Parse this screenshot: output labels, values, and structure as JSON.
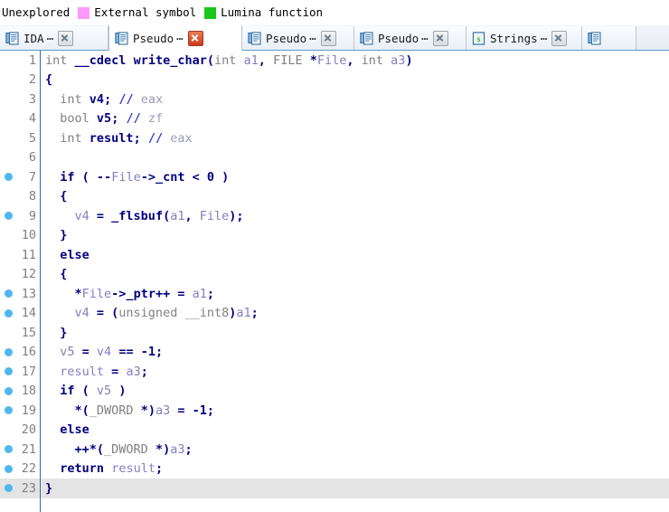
{
  "legend": {
    "items": [
      {
        "label": "Unexplored",
        "swatch": null,
        "icon_name": "legend-label-unexplored"
      },
      {
        "label": "External symbol",
        "swatch": "#ff99ff",
        "icon_name": "legend-swatch-external-symbol"
      },
      {
        "label": "Lumina function",
        "swatch": "#19c819",
        "icon_name": "legend-swatch-lumina-function"
      }
    ]
  },
  "tabs": [
    {
      "label": "IDA",
      "ellipsis": "⋯",
      "icon_name": "document-icon",
      "close_icon": "close-icon",
      "active": false,
      "close_style": "grey"
    },
    {
      "label": "Pseudo",
      "ellipsis": "⋯",
      "icon_name": "document-icon",
      "close_icon": "close-icon",
      "active": true,
      "close_style": "red"
    },
    {
      "label": "Pseudo",
      "ellipsis": "⋯",
      "icon_name": "document-icon",
      "close_icon": "close-icon",
      "active": false,
      "close_style": "grey"
    },
    {
      "label": "Pseudo",
      "ellipsis": "⋯",
      "icon_name": "document-icon",
      "close_icon": "close-icon",
      "active": false,
      "close_style": "grey"
    },
    {
      "label": "Strings",
      "ellipsis": "⋯",
      "icon_name": "strings-icon",
      "close_icon": "close-icon",
      "active": false,
      "close_style": "grey"
    },
    {
      "label": "",
      "ellipsis": "",
      "icon_name": "document-icon",
      "close_icon": "",
      "active": false,
      "close_style": "none"
    }
  ],
  "code": {
    "function_signature": "int __cdecl write_char(int a1, FILE *File, int a3)",
    "lines": [
      {
        "no": "1",
        "bp": false,
        "highlight": false,
        "tokens": [
          {
            "t": "int",
            "c": "t-type"
          },
          {
            "t": " ",
            "c": "t-plain"
          },
          {
            "t": "__cdecl",
            "c": "t-kw"
          },
          {
            "t": " ",
            "c": "t-plain"
          },
          {
            "t": "write_char",
            "c": "t-fn"
          },
          {
            "t": "(",
            "c": "t-punc"
          },
          {
            "t": "int",
            "c": "t-type"
          },
          {
            "t": " ",
            "c": "t-plain"
          },
          {
            "t": "a1",
            "c": "t-var"
          },
          {
            "t": ", ",
            "c": "t-punc"
          },
          {
            "t": "FILE",
            "c": "t-type"
          },
          {
            "t": " ",
            "c": "t-plain"
          },
          {
            "t": "*",
            "c": "t-punc"
          },
          {
            "t": "File",
            "c": "t-var"
          },
          {
            "t": ", ",
            "c": "t-punc"
          },
          {
            "t": "int",
            "c": "t-type"
          },
          {
            "t": " ",
            "c": "t-plain"
          },
          {
            "t": "a3",
            "c": "t-var"
          },
          {
            "t": ")",
            "c": "t-punc"
          }
        ]
      },
      {
        "no": "2",
        "bp": false,
        "highlight": false,
        "tokens": [
          {
            "t": "{",
            "c": "t-punc"
          }
        ]
      },
      {
        "no": "3",
        "bp": false,
        "highlight": false,
        "tokens": [
          {
            "t": "  ",
            "c": "t-plain"
          },
          {
            "t": "int",
            "c": "t-type"
          },
          {
            "t": " ",
            "c": "t-plain"
          },
          {
            "t": "v4",
            "c": "t-plain"
          },
          {
            "t": "; ",
            "c": "t-punc"
          },
          {
            "t": "//",
            "c": "t-cmtm"
          },
          {
            "t": " eax",
            "c": "t-cmt"
          }
        ]
      },
      {
        "no": "4",
        "bp": false,
        "highlight": false,
        "tokens": [
          {
            "t": "  ",
            "c": "t-plain"
          },
          {
            "t": "bool",
            "c": "t-type"
          },
          {
            "t": " ",
            "c": "t-plain"
          },
          {
            "t": "v5",
            "c": "t-plain"
          },
          {
            "t": "; ",
            "c": "t-punc"
          },
          {
            "t": "//",
            "c": "t-cmtm"
          },
          {
            "t": " zf",
            "c": "t-cmt"
          }
        ]
      },
      {
        "no": "5",
        "bp": false,
        "highlight": false,
        "tokens": [
          {
            "t": "  ",
            "c": "t-plain"
          },
          {
            "t": "int",
            "c": "t-type"
          },
          {
            "t": " ",
            "c": "t-plain"
          },
          {
            "t": "result",
            "c": "t-plain"
          },
          {
            "t": "; ",
            "c": "t-punc"
          },
          {
            "t": "//",
            "c": "t-cmtm"
          },
          {
            "t": " eax",
            "c": "t-cmt"
          }
        ]
      },
      {
        "no": "6",
        "bp": false,
        "highlight": false,
        "tokens": [
          {
            "t": "",
            "c": "t-plain"
          }
        ]
      },
      {
        "no": "7",
        "bp": true,
        "highlight": false,
        "tokens": [
          {
            "t": "  ",
            "c": "t-plain"
          },
          {
            "t": "if",
            "c": "t-kw"
          },
          {
            "t": " ( ",
            "c": "t-punc"
          },
          {
            "t": "--",
            "c": "t-punc"
          },
          {
            "t": "File",
            "c": "t-var"
          },
          {
            "t": "->",
            "c": "t-punc"
          },
          {
            "t": "_cnt",
            "c": "t-mem"
          },
          {
            "t": " < ",
            "c": "t-punc"
          },
          {
            "t": "0",
            "c": "t-num"
          },
          {
            "t": " )",
            "c": "t-punc"
          }
        ]
      },
      {
        "no": "8",
        "bp": false,
        "highlight": false,
        "tokens": [
          {
            "t": "  ",
            "c": "t-plain"
          },
          {
            "t": "{",
            "c": "t-punc"
          }
        ]
      },
      {
        "no": "9",
        "bp": true,
        "highlight": false,
        "tokens": [
          {
            "t": "    ",
            "c": "t-plain"
          },
          {
            "t": "v4",
            "c": "t-var"
          },
          {
            "t": " = ",
            "c": "t-punc"
          },
          {
            "t": "_flsbuf",
            "c": "t-fn"
          },
          {
            "t": "(",
            "c": "t-punc"
          },
          {
            "t": "a1",
            "c": "t-var"
          },
          {
            "t": ", ",
            "c": "t-punc"
          },
          {
            "t": "File",
            "c": "t-var"
          },
          {
            "t": ");",
            "c": "t-punc"
          }
        ]
      },
      {
        "no": "10",
        "bp": false,
        "highlight": false,
        "tokens": [
          {
            "t": "  ",
            "c": "t-plain"
          },
          {
            "t": "}",
            "c": "t-punc"
          }
        ]
      },
      {
        "no": "11",
        "bp": false,
        "highlight": false,
        "tokens": [
          {
            "t": "  ",
            "c": "t-plain"
          },
          {
            "t": "else",
            "c": "t-kw"
          }
        ]
      },
      {
        "no": "12",
        "bp": false,
        "highlight": false,
        "tokens": [
          {
            "t": "  ",
            "c": "t-plain"
          },
          {
            "t": "{",
            "c": "t-punc"
          }
        ]
      },
      {
        "no": "13",
        "bp": true,
        "highlight": false,
        "tokens": [
          {
            "t": "    ",
            "c": "t-plain"
          },
          {
            "t": "*",
            "c": "t-punc"
          },
          {
            "t": "File",
            "c": "t-var"
          },
          {
            "t": "->",
            "c": "t-punc"
          },
          {
            "t": "_ptr",
            "c": "t-mem"
          },
          {
            "t": "++ = ",
            "c": "t-punc"
          },
          {
            "t": "a1",
            "c": "t-var"
          },
          {
            "t": ";",
            "c": "t-punc"
          }
        ]
      },
      {
        "no": "14",
        "bp": true,
        "highlight": false,
        "tokens": [
          {
            "t": "    ",
            "c": "t-plain"
          },
          {
            "t": "v4",
            "c": "t-var"
          },
          {
            "t": " = (",
            "c": "t-punc"
          },
          {
            "t": "unsigned __int8",
            "c": "t-type"
          },
          {
            "t": ")",
            "c": "t-punc"
          },
          {
            "t": "a1",
            "c": "t-var"
          },
          {
            "t": ";",
            "c": "t-punc"
          }
        ]
      },
      {
        "no": "15",
        "bp": false,
        "highlight": false,
        "tokens": [
          {
            "t": "  ",
            "c": "t-plain"
          },
          {
            "t": "}",
            "c": "t-punc"
          }
        ]
      },
      {
        "no": "16",
        "bp": true,
        "highlight": false,
        "tokens": [
          {
            "t": "  ",
            "c": "t-plain"
          },
          {
            "t": "v5",
            "c": "t-var"
          },
          {
            "t": " = ",
            "c": "t-punc"
          },
          {
            "t": "v4",
            "c": "t-var"
          },
          {
            "t": " == ",
            "c": "t-punc"
          },
          {
            "t": "-1",
            "c": "t-num"
          },
          {
            "t": ";",
            "c": "t-punc"
          }
        ]
      },
      {
        "no": "17",
        "bp": true,
        "highlight": false,
        "tokens": [
          {
            "t": "  ",
            "c": "t-plain"
          },
          {
            "t": "result",
            "c": "t-var"
          },
          {
            "t": " = ",
            "c": "t-punc"
          },
          {
            "t": "a3",
            "c": "t-var"
          },
          {
            "t": ";",
            "c": "t-punc"
          }
        ]
      },
      {
        "no": "18",
        "bp": true,
        "highlight": false,
        "tokens": [
          {
            "t": "  ",
            "c": "t-plain"
          },
          {
            "t": "if",
            "c": "t-kw"
          },
          {
            "t": " ( ",
            "c": "t-punc"
          },
          {
            "t": "v5",
            "c": "t-var"
          },
          {
            "t": " )",
            "c": "t-punc"
          }
        ]
      },
      {
        "no": "19",
        "bp": true,
        "highlight": false,
        "tokens": [
          {
            "t": "    ",
            "c": "t-plain"
          },
          {
            "t": "*(",
            "c": "t-punc"
          },
          {
            "t": "_DWORD",
            "c": "t-type"
          },
          {
            "t": " ",
            "c": "t-plain"
          },
          {
            "t": "*)",
            "c": "t-punc"
          },
          {
            "t": "a3",
            "c": "t-var"
          },
          {
            "t": " = ",
            "c": "t-punc"
          },
          {
            "t": "-1",
            "c": "t-num"
          },
          {
            "t": ";",
            "c": "t-punc"
          }
        ]
      },
      {
        "no": "20",
        "bp": false,
        "highlight": false,
        "tokens": [
          {
            "t": "  ",
            "c": "t-plain"
          },
          {
            "t": "else",
            "c": "t-kw"
          }
        ]
      },
      {
        "no": "21",
        "bp": true,
        "highlight": false,
        "tokens": [
          {
            "t": "    ",
            "c": "t-plain"
          },
          {
            "t": "++*(",
            "c": "t-punc"
          },
          {
            "t": "_DWORD",
            "c": "t-type"
          },
          {
            "t": " ",
            "c": "t-plain"
          },
          {
            "t": "*)",
            "c": "t-punc"
          },
          {
            "t": "a3",
            "c": "t-var"
          },
          {
            "t": ";",
            "c": "t-punc"
          }
        ]
      },
      {
        "no": "22",
        "bp": true,
        "highlight": false,
        "tokens": [
          {
            "t": "  ",
            "c": "t-plain"
          },
          {
            "t": "return",
            "c": "t-kw"
          },
          {
            "t": " ",
            "c": "t-plain"
          },
          {
            "t": "result",
            "c": "t-var"
          },
          {
            "t": ";",
            "c": "t-punc"
          }
        ]
      },
      {
        "no": "23",
        "bp": true,
        "highlight": true,
        "tokens": [
          {
            "t": "}",
            "c": "t-punc"
          }
        ]
      }
    ]
  }
}
